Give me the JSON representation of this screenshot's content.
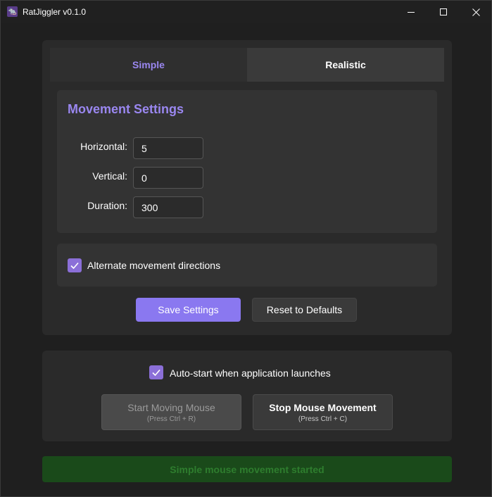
{
  "window": {
    "title": "RatJiggler v0.1.0",
    "controls": [
      "minimize",
      "maximize",
      "close"
    ]
  },
  "tabs": [
    {
      "label": "Simple",
      "active": true
    },
    {
      "label": "Realistic",
      "active": false
    }
  ],
  "movement_settings": {
    "title": "Movement Settings",
    "fields": [
      {
        "label": "Horizontal:",
        "value": "5"
      },
      {
        "label": "Vertical:",
        "value": "0"
      },
      {
        "label": "Duration:",
        "value": "300"
      }
    ]
  },
  "alternate": {
    "label": "Alternate movement directions",
    "checked": true
  },
  "actions": {
    "save_label": "Save Settings",
    "reset_label": "Reset to Defaults"
  },
  "autostart": {
    "label": "Auto-start when application launches",
    "checked": true
  },
  "controls": {
    "start": {
      "label": "Start Moving Mouse",
      "shortcut": "(Press Ctrl + R)",
      "enabled": false
    },
    "stop": {
      "label": "Stop Mouse Movement",
      "shortcut": "(Press Ctrl + C)",
      "enabled": true
    }
  },
  "status": {
    "text": "Simple mouse movement started"
  },
  "colors": {
    "accent": "#9a87f0",
    "checkbox": "#8b6fd8",
    "save_button": "#8a78f0",
    "status_bg": "#1a4a1a",
    "status_text": "#2e7d2e"
  },
  "icons": {
    "app": "rat-app-icon",
    "minimize": "minimize-icon",
    "maximize": "maximize-icon",
    "close": "close-icon",
    "check": "checkmark-icon"
  }
}
